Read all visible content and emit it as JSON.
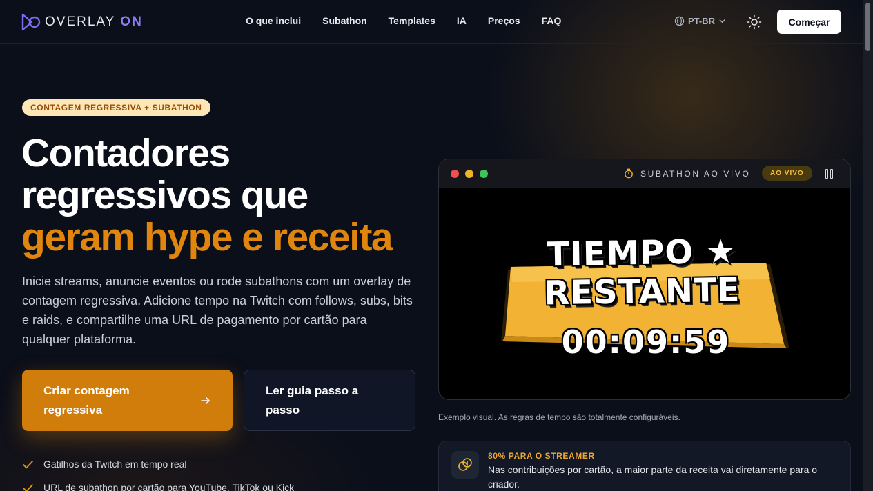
{
  "nav": {
    "logo_text_main": "OVERLAY",
    "logo_text_accent": "ON",
    "menu": [
      "O que inclui",
      "Subathon",
      "Templates",
      "IA",
      "Preços",
      "FAQ"
    ],
    "language": "PT-BR",
    "cta_label": "Começar"
  },
  "hero": {
    "badge": "CONTAGEM REGRESSIVA + SUBATHON",
    "title_line1": "Contadores",
    "title_line2": "regressivos que",
    "title_accent": "geram hype e receita",
    "lead": "Inicie streams, anuncie eventos ou rode subathons com um overlay de contagem regressiva. Adicione tempo na Twitch com follows, subs, bits e raids, e compartilhe uma URL de pagamento por cartão para qualquer plataforma.",
    "primary_cta": "Criar contagem regressiva",
    "secondary_cta": "Ler guia passo a passo",
    "features": [
      "Gatilhos da Twitch em tempo real",
      "URL de subathon por cartão para YouTube, TikTok ou Kick"
    ]
  },
  "preview": {
    "window_title": "SUBATHON AO VIVO",
    "live_badge": "AO VIVO",
    "overlay_heading": "TIEMPO ★ RESTANTE",
    "timer": "00:09:59",
    "caption": "Exemplo visual. As regras de tempo são totalmente configuráveis.",
    "colors": {
      "banner": "#f2b233",
      "accent": "#e0850e"
    }
  },
  "streamer_card": {
    "title": "80% PARA O STREAMER",
    "text": "Nas contribuições por cartão, a maior parte da receita vai diretamente para o criador."
  }
}
